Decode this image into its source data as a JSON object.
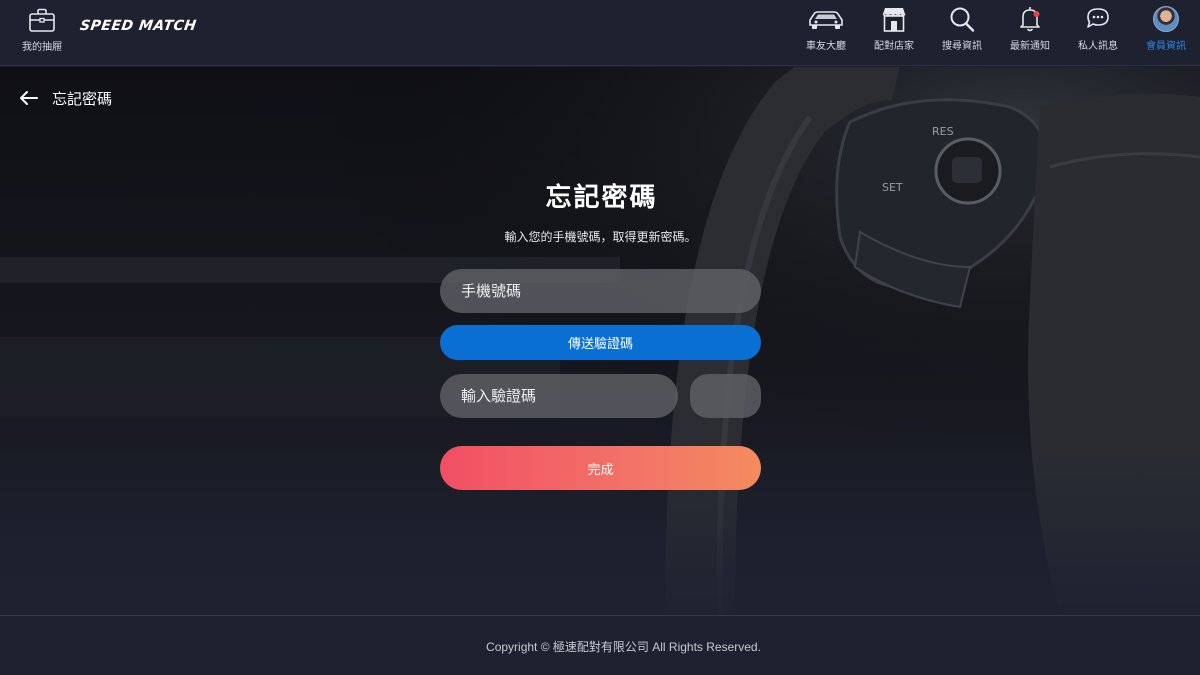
{
  "header": {
    "drawer_label": "我的抽屜",
    "logo_text": "SPEED MATCH",
    "nav": [
      {
        "label": "車友大廳",
        "icon": "car-icon"
      },
      {
        "label": "配對店家",
        "icon": "store-icon"
      },
      {
        "label": "搜尋資訊",
        "icon": "search-icon"
      },
      {
        "label": "最新通知",
        "icon": "bell-icon"
      },
      {
        "label": "私人訊息",
        "icon": "chat-icon"
      },
      {
        "label": "會員資訊",
        "icon": "avatar"
      }
    ],
    "active_color": "#2e86e8",
    "notification_dot_color": "#e8433f"
  },
  "page": {
    "back_label": "忘記密碼",
    "title": "忘記密碼",
    "subtitle": "輸入您的手機號碼，取得更新密碼。",
    "phone_placeholder": "手機號碼",
    "send_code_label": "傳送驗證碼",
    "code_placeholder": "輸入驗證碼",
    "done_label": "完成"
  },
  "colors": {
    "send_button": "#0a6fd2",
    "done_gradient_start": "#f14f64",
    "done_gradient_end": "#f48b5f"
  },
  "footer": {
    "copyright": "Copyright © 極速配對有限公司 All Rights Reserved."
  }
}
